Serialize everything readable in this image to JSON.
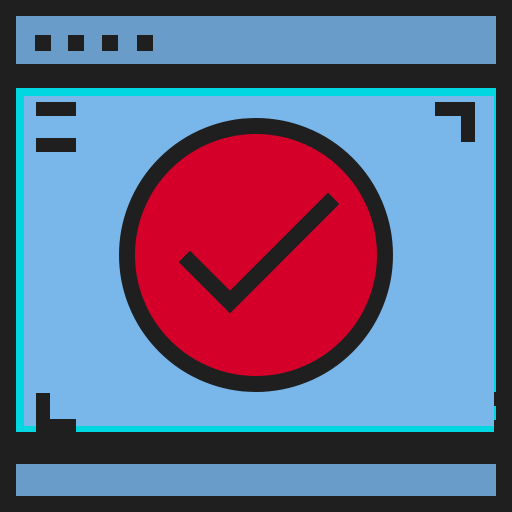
{
  "icon": {
    "name": "browser-window-checkmark-icon",
    "window_dots_count": 4
  },
  "colors": {
    "outline": "#1f1f1f",
    "title_bar": "#6a9cc9",
    "frame": "#00d7e1",
    "screen": "#79b6e9",
    "badge": "#d4002a",
    "footer_bar": "#6a9cc9"
  }
}
